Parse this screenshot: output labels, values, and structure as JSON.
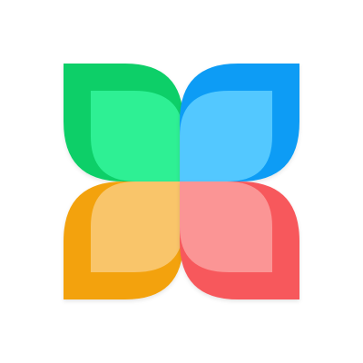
{
  "logo": {
    "icon": "four-petal-flower-icon",
    "petals": [
      {
        "name": "top-left",
        "outer_color": "#0fcf68",
        "inner_color": "#2ef094"
      },
      {
        "name": "top-right",
        "outer_color": "#0a9cf5",
        "inner_color": "#52c8ff"
      },
      {
        "name": "bottom-left",
        "outer_color": "#f3a20d",
        "inner_color": "#f9c56b"
      },
      {
        "name": "bottom-right",
        "outer_color": "#f7585b",
        "inner_color": "#fb9595"
      }
    ]
  }
}
